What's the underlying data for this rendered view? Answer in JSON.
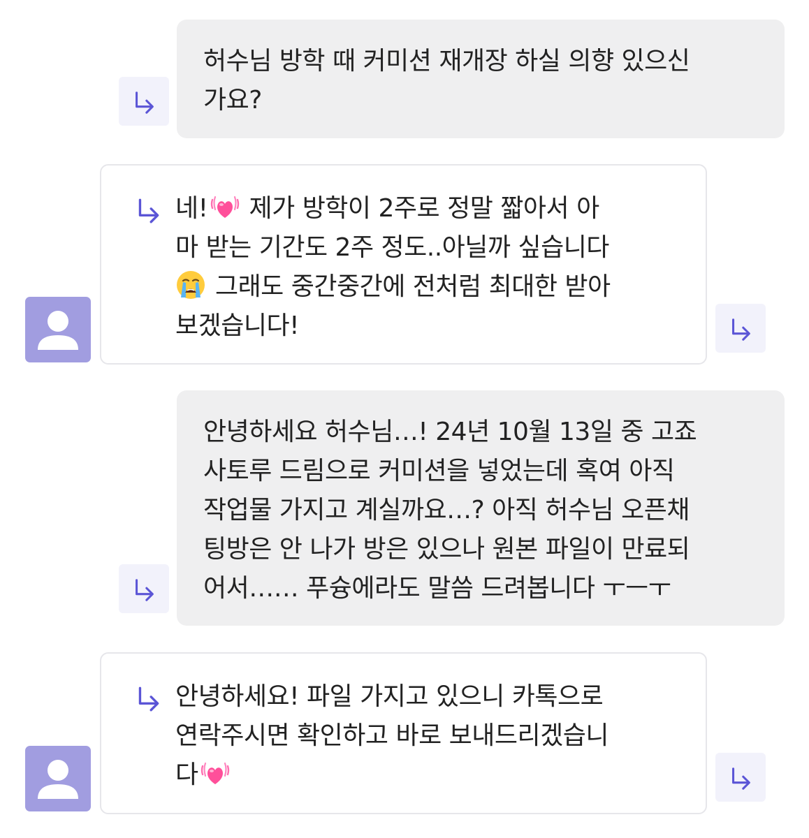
{
  "thread": {
    "q1": {
      "lines": [
        "허수님 방학 때 커미션 재개장 하실 의향 있으신",
        "가요?"
      ]
    },
    "a1": {
      "line1_before": "네!",
      "line1_emoji": "growing-heart",
      "line1_after": " 제가 방학이 2주로 정말 짧아서 아",
      "line2": "마 받는 기간도 2주 정도..아닐까 싶습니다",
      "line3_emoji": "loudly-crying-face",
      "line3_after": " 그래도 중간중간에 전처럼 최대한 받아",
      "line4": "보겠습니다!"
    },
    "q2": {
      "lines": [
        "안녕하세요 허수님…! 24년 10월 13일 중 고죠",
        "사토루 드림으로 커미션을 넣었는데 혹여 아직",
        "작업물 가지고 계실까요…? 아직 허수님 오픈채",
        "팅방은 안 나가 방은 있으나 원본 파일이 만료되",
        "어서…… 푸슝에라도 말씀 드려봅니다 ㅜㅡㅜ"
      ]
    },
    "a2": {
      "line1": "안녕하세요! 파일 가지고 있으니 카톡으로",
      "line2": "연락주시면 확인하고 바로 보내드리겠습니",
      "line3_before": "다",
      "line3_emoji": "growing-heart"
    }
  },
  "icons": {
    "reply_arrow": "reply-arrow-icon",
    "avatar": "user-avatar-icon"
  },
  "colors": {
    "accent": "#5b55d6",
    "avatar_bg": "#a19de0",
    "question_bg": "#efeff0",
    "reply_btn_bg": "#f2f2fb",
    "answer_border": "#e6e6ea",
    "heart": "#ff4f9a"
  }
}
